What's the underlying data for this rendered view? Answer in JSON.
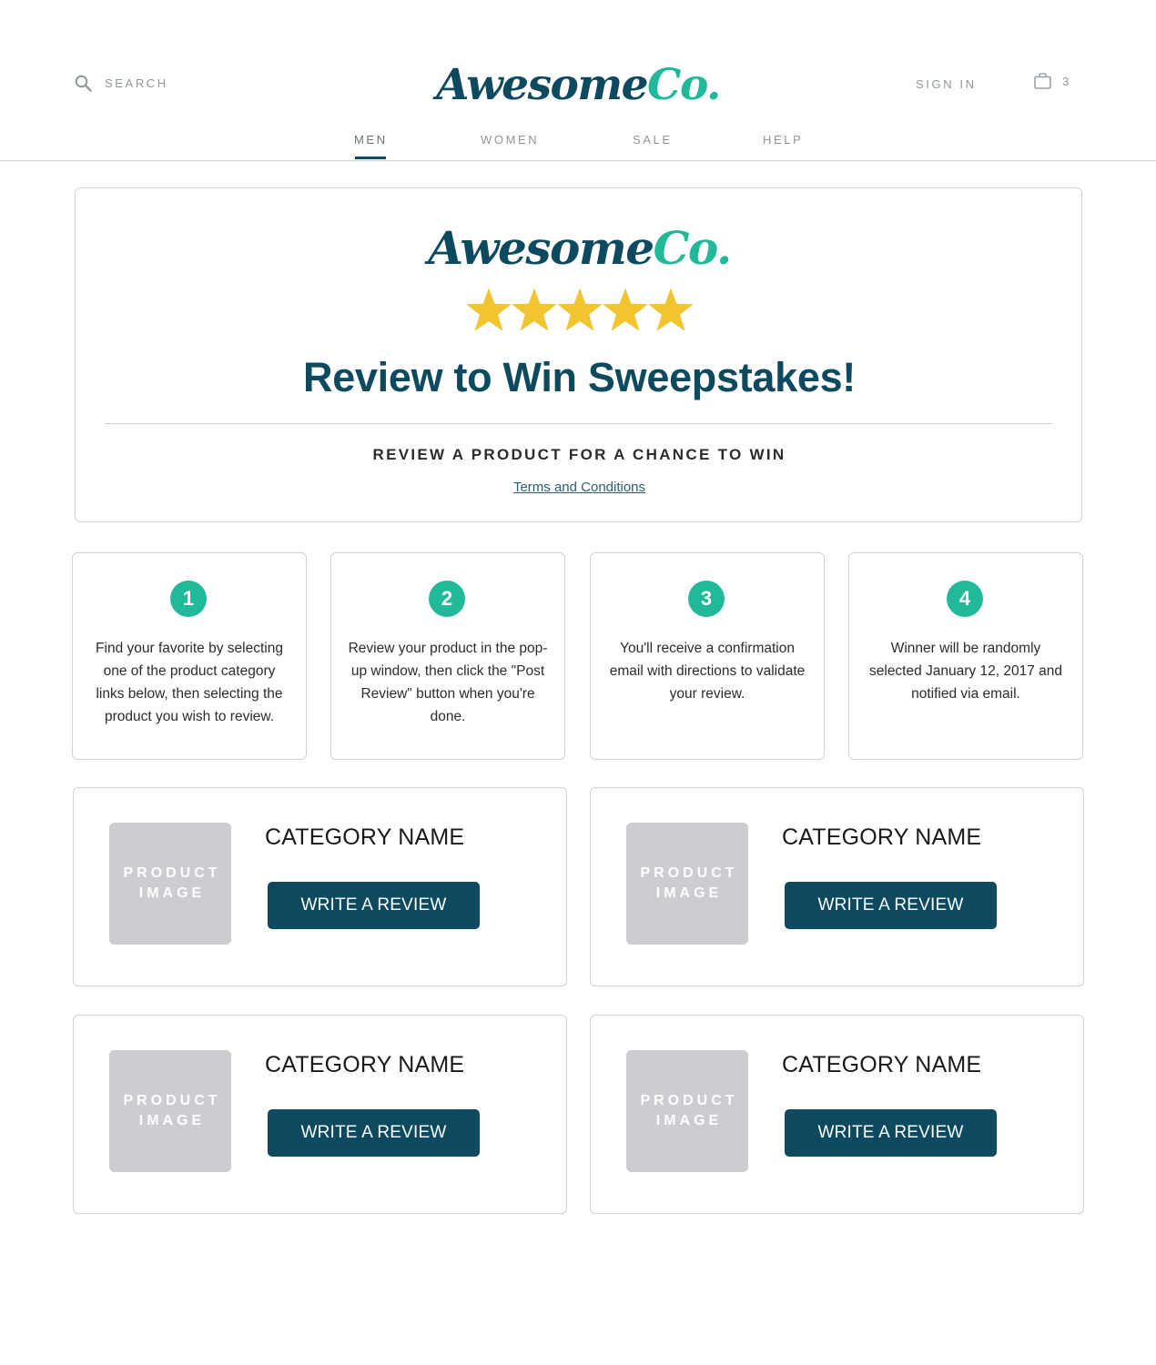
{
  "header": {
    "search_label": "SEARCH",
    "logo_part1": "Awesome",
    "logo_part2": "Co.",
    "signin_label": "SIGN IN",
    "cart_count": "3",
    "nav": [
      {
        "label": "MEN",
        "active": true
      },
      {
        "label": "WOMEN",
        "active": false
      },
      {
        "label": "SALE",
        "active": false
      },
      {
        "label": "HELP",
        "active": false
      }
    ]
  },
  "hero": {
    "logo_part1": "Awesome",
    "logo_part2": "Co.",
    "rating": 5,
    "rating_max": 5,
    "title": "Review to Win Sweepstakes!",
    "subtitle": "REVIEW A PRODUCT FOR A CHANCE TO WIN",
    "terms_link": "Terms and Conditions"
  },
  "steps": [
    {
      "number": "1",
      "text": "Find your favorite by selecting one of the product category links below, then selecting the product you wish to review."
    },
    {
      "number": "2",
      "text": "Review your product in the pop-up window, then click the \"Post Review\" button when you're done."
    },
    {
      "number": "3",
      "text": "You'll receive a confirmation email with directions to validate your review."
    },
    {
      "number": "4",
      "text": "Winner will be randomly selected January 12, 2017 and notified via email."
    }
  ],
  "categories": [
    {
      "image_label_1": "PRODUCT",
      "image_label_2": "IMAGE",
      "name": "CATEGORY NAME",
      "button": "WRITE A REVIEW"
    },
    {
      "image_label_1": "PRODUCT",
      "image_label_2": "IMAGE",
      "name": "CATEGORY NAME",
      "button": "WRITE A REVIEW"
    },
    {
      "image_label_1": "PRODUCT",
      "image_label_2": "IMAGE",
      "name": "CATEGORY NAME",
      "button": "WRITE A REVIEW"
    },
    {
      "image_label_1": "PRODUCT",
      "image_label_2": "IMAGE",
      "name": "CATEGORY NAME",
      "button": "WRITE A REVIEW"
    }
  ],
  "colors": {
    "brand_dark": "#0d4a60",
    "brand_accent": "#21b99a",
    "star": "#f2c42f",
    "placeholder": "#cccdd1"
  },
  "icons": [
    "search-icon",
    "bag-icon",
    "star-icon"
  ]
}
